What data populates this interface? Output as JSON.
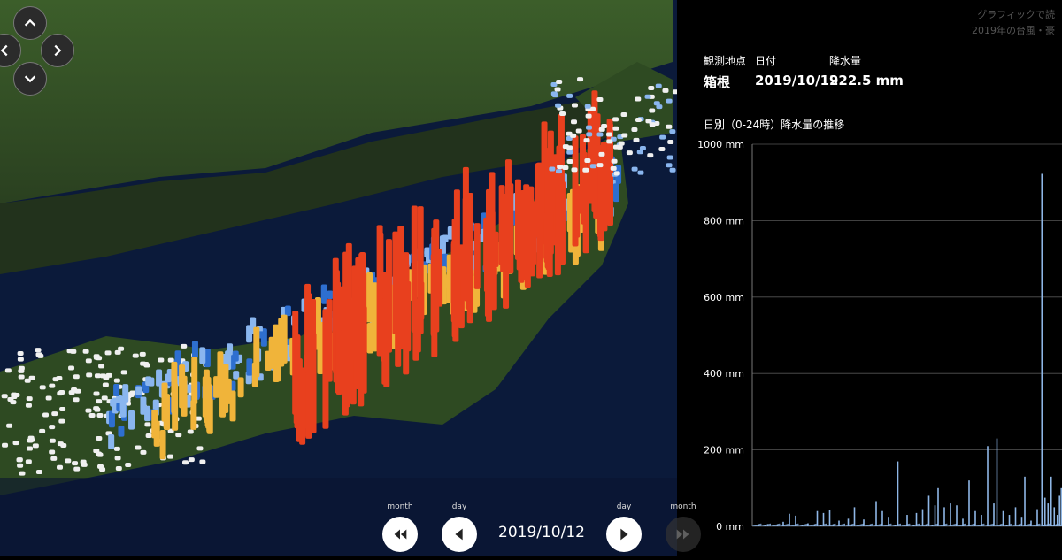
{
  "credit": {
    "line1": "グラフィックで読",
    "line2": "2019年の台風・豪"
  },
  "info": {
    "station_label": "観測地点",
    "date_label": "日付",
    "rain_label": "降水量",
    "station_value": "箱根",
    "date_value": "2019/10/12",
    "rain_value": "922.5 mm"
  },
  "chart_title": "日別（0-24時）降水量の推移",
  "controls": {
    "month_prev_label": "month",
    "day_prev_label": "day",
    "day_next_label": "day",
    "month_next_label": "month",
    "current_date": "2019/10/12"
  },
  "colors": {
    "bar": "#8fb7e6",
    "red": "#e8401e",
    "orange": "#f0b43a",
    "blue": "#2e6fd0",
    "light_blue": "#8ab6ef",
    "white": "#f0f0f0"
  },
  "icons": {
    "up": "chevron-up-icon",
    "down": "chevron-down-icon",
    "left": "chevron-left-icon",
    "right": "chevron-right-icon"
  },
  "chart_data": {
    "type": "bar",
    "title": "日別（0-24時）降水量の推移",
    "ylabel": "",
    "ylim": [
      0,
      1000
    ],
    "yticks": [
      "0 mm",
      "200 mm",
      "400 mm",
      "600 mm",
      "800 mm",
      "1000 mm"
    ],
    "grid": true,
    "spikes": [
      {
        "x": 0.02,
        "v": 4
      },
      {
        "x": 0.05,
        "v": 6
      },
      {
        "x": 0.1,
        "v": 12
      },
      {
        "x": 0.12,
        "v": 33
      },
      {
        "x": 0.14,
        "v": 28
      },
      {
        "x": 0.18,
        "v": 8
      },
      {
        "x": 0.21,
        "v": 40
      },
      {
        "x": 0.23,
        "v": 35
      },
      {
        "x": 0.25,
        "v": 42
      },
      {
        "x": 0.28,
        "v": 15
      },
      {
        "x": 0.31,
        "v": 20
      },
      {
        "x": 0.33,
        "v": 50
      },
      {
        "x": 0.36,
        "v": 18
      },
      {
        "x": 0.4,
        "v": 66
      },
      {
        "x": 0.42,
        "v": 40
      },
      {
        "x": 0.44,
        "v": 25
      },
      {
        "x": 0.47,
        "v": 170
      },
      {
        "x": 0.5,
        "v": 30
      },
      {
        "x": 0.53,
        "v": 35
      },
      {
        "x": 0.55,
        "v": 45
      },
      {
        "x": 0.57,
        "v": 80
      },
      {
        "x": 0.59,
        "v": 55
      },
      {
        "x": 0.6,
        "v": 100
      },
      {
        "x": 0.62,
        "v": 50
      },
      {
        "x": 0.64,
        "v": 60
      },
      {
        "x": 0.66,
        "v": 55
      },
      {
        "x": 0.68,
        "v": 20
      },
      {
        "x": 0.7,
        "v": 120
      },
      {
        "x": 0.72,
        "v": 40
      },
      {
        "x": 0.74,
        "v": 30
      },
      {
        "x": 0.76,
        "v": 210
      },
      {
        "x": 0.78,
        "v": 60
      },
      {
        "x": 0.79,
        "v": 230
      },
      {
        "x": 0.81,
        "v": 40
      },
      {
        "x": 0.83,
        "v": 30
      },
      {
        "x": 0.85,
        "v": 50
      },
      {
        "x": 0.87,
        "v": 25
      },
      {
        "x": 0.88,
        "v": 130
      },
      {
        "x": 0.9,
        "v": 15
      },
      {
        "x": 0.92,
        "v": 45
      },
      {
        "x": 0.935,
        "v": 922.5
      },
      {
        "x": 0.945,
        "v": 75
      },
      {
        "x": 0.955,
        "v": 60
      },
      {
        "x": 0.965,
        "v": 130
      },
      {
        "x": 0.975,
        "v": 50
      },
      {
        "x": 0.985,
        "v": 30
      },
      {
        "x": 0.992,
        "v": 80
      },
      {
        "x": 0.998,
        "v": 100
      }
    ]
  }
}
